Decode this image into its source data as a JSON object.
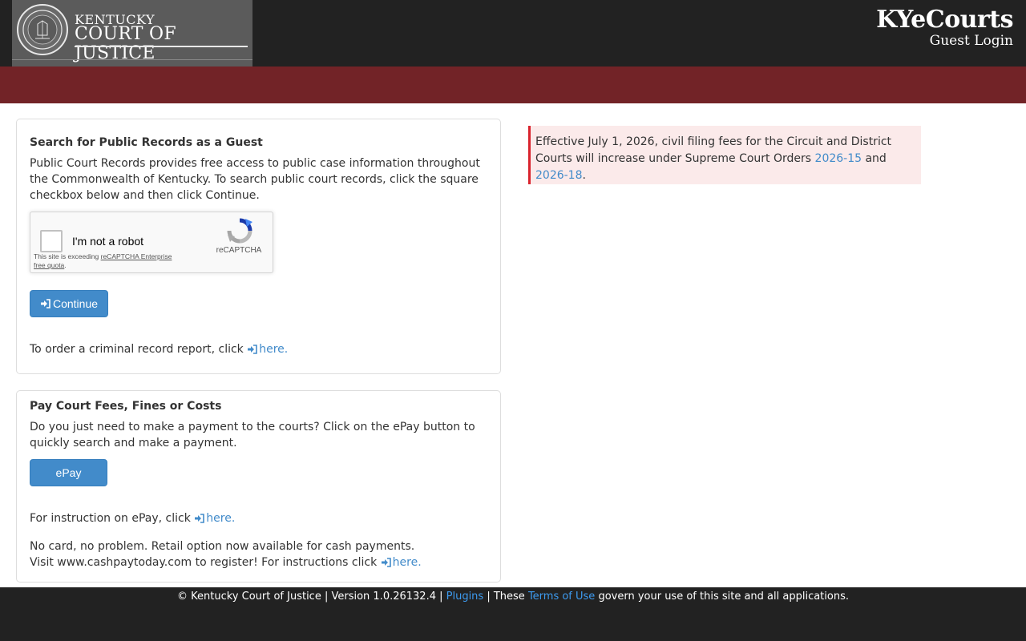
{
  "header": {
    "logo_line1": "KENTUCKY",
    "logo_line2": "COURT OF JUSTICE",
    "brand_title": "KYeCourts",
    "brand_subtitle": "Guest Login"
  },
  "search_card": {
    "title": "Search for Public Records as a Guest",
    "description": "Public Court Records provides free access to public case information throughout the Commonwealth of Kentucky. To search public court records, click the square checkbox below and then click Continue.",
    "recaptcha": {
      "label": "I'm not a robot",
      "brand": "reCAPTCHA",
      "warning_prefix": "This site is exceeding ",
      "warning_link": "reCAPTCHA Enterprise free quota",
      "warning_suffix": "."
    },
    "continue_label": "Continue",
    "criminal_text": "To order a criminal record report, click",
    "criminal_link": "here."
  },
  "pay_card": {
    "title": "Pay Court Fees, Fines or Costs",
    "description": "Do you just need to make a payment to the courts? Click on the ePay button to quickly search and make a payment.",
    "epay_label": "ePay",
    "instruction_text": "For instruction on ePay, click",
    "instruction_link": "here.",
    "cash_text": "No card, no problem. Retail option now available for cash payments. Visit www.cashpaytoday.com to register! For instructions click",
    "cash_link": "here."
  },
  "alert": {
    "text_before": "Effective July 1, 2026, civil filing fees for the Circuit and District Courts will increase under Supreme Court Orders ",
    "link1": "2026-15",
    "middle": " and ",
    "link2": "2026-18",
    "end": "."
  },
  "footer": {
    "copyright": "© Kentucky Court of Justice | Version 1.0.26132.4 | ",
    "plugins_link": "Plugins",
    "middle": " | These ",
    "terms_link": "Terms of Use",
    "end": " govern your use of this site and all applications."
  },
  "colors": {
    "header_bg": "#222222",
    "red_bar": "#722327",
    "button_blue": "#428bca",
    "alert_bg": "#fbeaea",
    "alert_border": "#d9232d",
    "link_blue": "#428bca"
  },
  "icons": {
    "seal": "kentucky-seal-icon",
    "continue": "sign-in-icon",
    "link": "sign-in-icon",
    "recaptcha": "recaptcha-logo-icon"
  }
}
